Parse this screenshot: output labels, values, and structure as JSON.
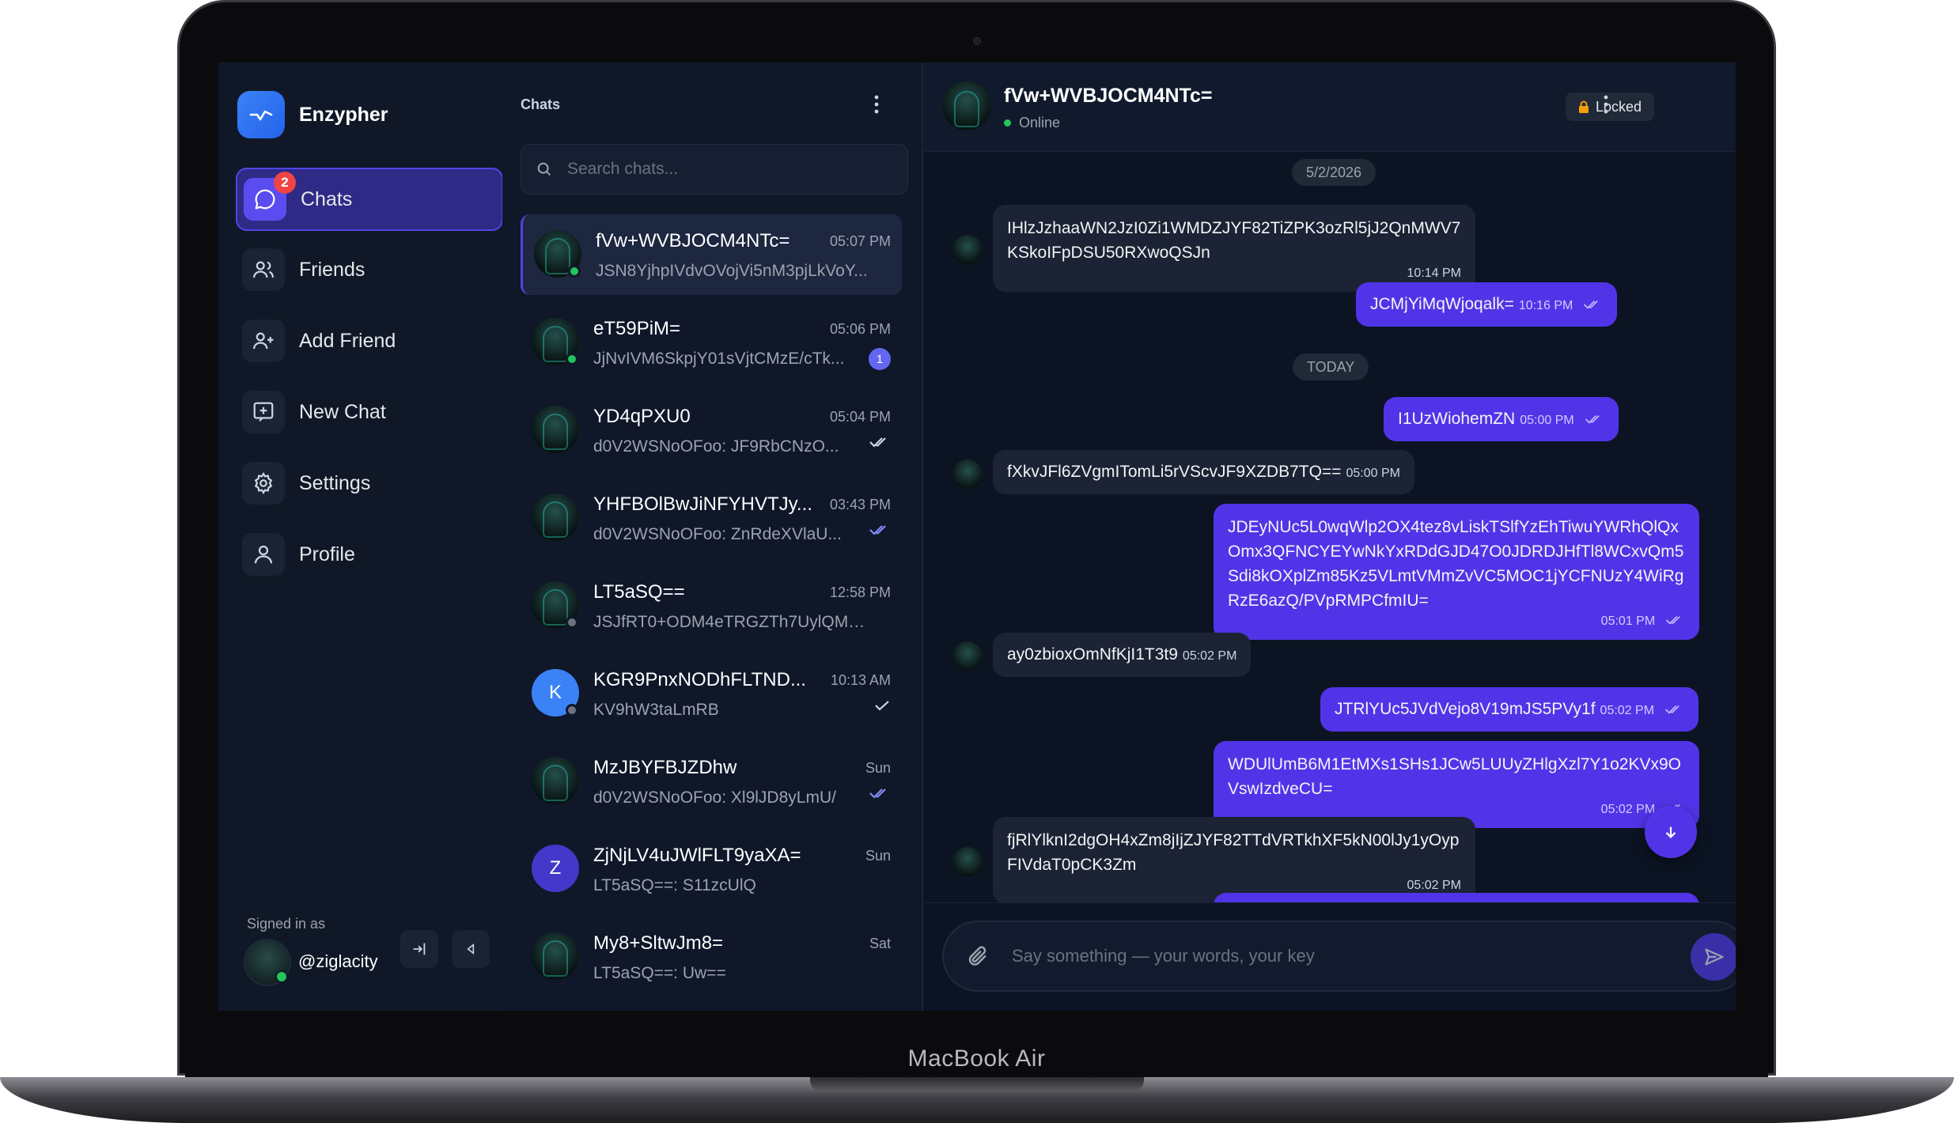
{
  "device": {
    "label": "MacBook Air"
  },
  "app": {
    "name": "Enzypher"
  },
  "nav": [
    {
      "label": "Chats",
      "icon": "chat-bubble-icon",
      "badge": "2",
      "active": true
    },
    {
      "label": "Friends",
      "icon": "users-icon"
    },
    {
      "label": "Add Friend",
      "icon": "user-plus-icon"
    },
    {
      "label": "New Chat",
      "icon": "message-plus-icon"
    },
    {
      "label": "Settings",
      "icon": "gear-icon"
    },
    {
      "label": "Profile",
      "icon": "user-icon"
    }
  ],
  "account": {
    "signed_in_label": "Signed in as",
    "username": "@ziglacity"
  },
  "chat_list": {
    "title": "Chats",
    "search_placeholder": "Search chats...",
    "items": [
      {
        "name": "fVw+WVBJOCM4NTc=",
        "time": "05:07 PM",
        "preview": "JSN8YjhpIVdvOVojVi5nM3pjLkVoY...",
        "status": "online",
        "active": true
      },
      {
        "name": "eT59PiM=",
        "time": "05:06 PM",
        "preview": "JjNvIVM6SkpjY01sVjtCMzE/cTk...",
        "status": "online",
        "unread": "1"
      },
      {
        "name": "YD4qPXU0",
        "time": "05:04 PM",
        "preview": "d0V2WSNoOFoo: JF9RbCNzO...",
        "receipt": "read"
      },
      {
        "name": "YHFBOlBwJiNFYHVTJy...",
        "time": "03:43 PM",
        "preview": "d0V2WSNoOFoo: ZnRdeXVlaU...",
        "receipt": "read-blue"
      },
      {
        "name": "LT5aSQ==",
        "time": "12:58 PM",
        "preview": "JSJfRT0+ODM4eTRGZTh7UylQM0...",
        "status": "offline"
      },
      {
        "name": "KGR9PnxNODhFLTND...",
        "time": "10:13 AM",
        "preview": "KV9hW3taLmRB",
        "status": "offline",
        "letter": "K",
        "receipt": "sent"
      },
      {
        "name": "MzJBYFBJZDhw",
        "time": "Sun",
        "preview": "d0V2WSNoOFoo: Xl9lJD8yLmU/",
        "receipt": "read-blue"
      },
      {
        "name": "ZjNjLV4uJWlFLT9yaXA=",
        "time": "Sun",
        "preview": "LT5aSQ==: S11zcUlQ",
        "letter": "Z"
      },
      {
        "name": "My8+SltwJm8=",
        "time": "Sat",
        "preview": "LT5aSQ==: Uw=="
      }
    ]
  },
  "conversation": {
    "name": "fVw+WVBJOCM4NTc=",
    "status": "Online",
    "lock_label": "Locked",
    "date_labels": [
      "5/2/2026",
      "TODAY"
    ],
    "messages": [
      {
        "dir": "in",
        "text": "IHlzJzhaaWN2JzI0Zi1WMDZJYF82TiZPK3ozRl5jJ2QnMWV7KSkoIFpDSU50RXwoQSJn",
        "time": "10:14 PM"
      },
      {
        "dir": "out",
        "text": "JCMjYiMqWjoqalk=",
        "time": "10:16 PM"
      },
      {
        "dir": "out",
        "text": "I1UzWiohemZN",
        "time": "05:00 PM"
      },
      {
        "dir": "in",
        "text": "fXkvJFl6ZVgmITomLi5rVScvJF9XZDB7TQ==",
        "time": "05:00 PM"
      },
      {
        "dir": "out",
        "text": "JDEyNUc5L0wqWlp2OX4tez8vLiskTSlfYzEhTiwuYWRhQlQxOmx3QFNCYEYwNkYxRDdGJD47O0JDRDJHfTl8WCxvQm5Sdi8kOXplZm85Kz5VLmtVMmZvVC5MOC1jYCFNUzY4WiRgRzE6azQ/PVpRMPCfmIU=",
        "time": "05:01 PM"
      },
      {
        "dir": "in",
        "text": "ay0zbioxOmNfKjI1T3t9",
        "time": "05:02 PM"
      },
      {
        "dir": "out",
        "text": "JTRlYUc5JVdVejo8V19mJS5PVy1f",
        "time": "05:02 PM"
      },
      {
        "dir": "out",
        "text": "WDUlUmB6M1EtMXs1SHs1JCw5LUUyZHlgXzl7Y1o2KVx9OVswIzdveCU=",
        "time": "05:02 PM"
      },
      {
        "dir": "in",
        "text": "fjRlYlknI2dgOH4xZm8jIjZJYF82TTdVRTkhXF5kN00lJy1yOypFIVdaT0pCK3Zm",
        "time": "05:02 PM"
      }
    ],
    "composer_placeholder": "Say something — your words, your key"
  },
  "colors": {
    "accent": "#5234e8",
    "online": "#22c55e",
    "badge": "#ef4444"
  }
}
